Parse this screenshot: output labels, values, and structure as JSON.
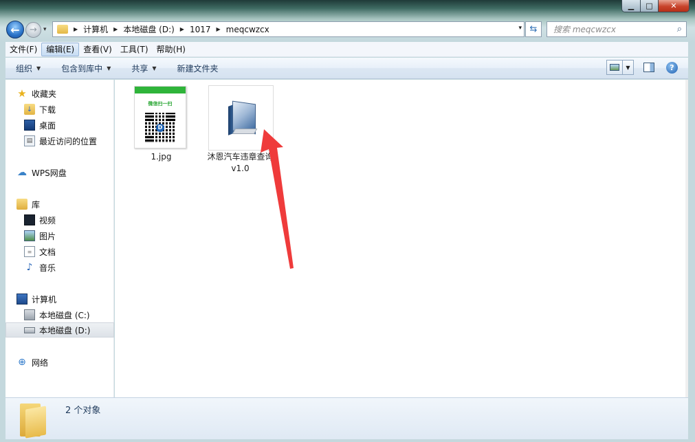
{
  "window": {
    "controls": {
      "minimize": "▁",
      "maximize": "□",
      "close": "✕"
    }
  },
  "nav": {
    "back_glyph": "←",
    "forward_glyph": "→",
    "history_glyph": "▾",
    "breadcrumb_sep": "▶",
    "breadcrumbs": [
      "计算机",
      "本地磁盘 (D:)",
      "1017",
      "meqcwzcx"
    ],
    "address_dropdown": "▾",
    "refresh_glyph": "⇆",
    "search_placeholder": "搜索 meqcwzcx",
    "search_glyph": "⌕"
  },
  "menubar": {
    "items": [
      "文件(F)",
      "编辑(E)",
      "查看(V)",
      "工具(T)",
      "帮助(H)"
    ],
    "active_index": 1
  },
  "toolbar": {
    "organize": "组织",
    "include_library": "包含到库中",
    "share": "共享",
    "new_folder": "新建文件夹",
    "caret": "▼",
    "help_glyph": "?"
  },
  "sidebar": {
    "favorites": {
      "label": "收藏夹",
      "icon": "star-icon",
      "glyph": "★"
    },
    "favorites_items": [
      {
        "label": "下载",
        "icon": "downloads-icon",
        "glyph": "↓"
      },
      {
        "label": "桌面",
        "icon": "desktop-icon",
        "glyph": ""
      },
      {
        "label": "最近访问的位置",
        "icon": "recent-places-icon",
        "glyph": "▤"
      }
    ],
    "wps": {
      "label": "WPS网盘",
      "icon": "cloud-icon",
      "glyph": "☁"
    },
    "library": {
      "label": "库",
      "icon": "library-icon",
      "glyph": ""
    },
    "library_items": [
      {
        "label": "视频",
        "icon": "video-icon",
        "glyph": ""
      },
      {
        "label": "图片",
        "icon": "pictures-icon",
        "glyph": ""
      },
      {
        "label": "文档",
        "icon": "documents-icon",
        "glyph": "≡"
      },
      {
        "label": "音乐",
        "icon": "music-icon",
        "glyph": "♪"
      }
    ],
    "computer": {
      "label": "计算机",
      "icon": "computer-icon",
      "glyph": ""
    },
    "computer_items": [
      {
        "label": "本地磁盘 (C:)",
        "icon": "drive-c-icon",
        "glyph": ""
      },
      {
        "label": "本地磁盘 (D:)",
        "icon": "drive-d-icon",
        "glyph": "",
        "selected": true
      }
    ],
    "network": {
      "label": "网络",
      "icon": "network-icon",
      "glyph": "⊕"
    }
  },
  "files": [
    {
      "name": "1.jpg",
      "type": "image",
      "thumb": {
        "top_text": "微信扫一扫",
        "qr_logo": "D"
      }
    },
    {
      "name": "沐恩汽车违章查询v1.0",
      "type": "application"
    }
  ],
  "status": {
    "count_text": "2 个对象"
  },
  "colors": {
    "annotation_arrow": "#ef3b3b",
    "toolbar_text": "#1e395b",
    "qr_green": "#2fb43a"
  }
}
